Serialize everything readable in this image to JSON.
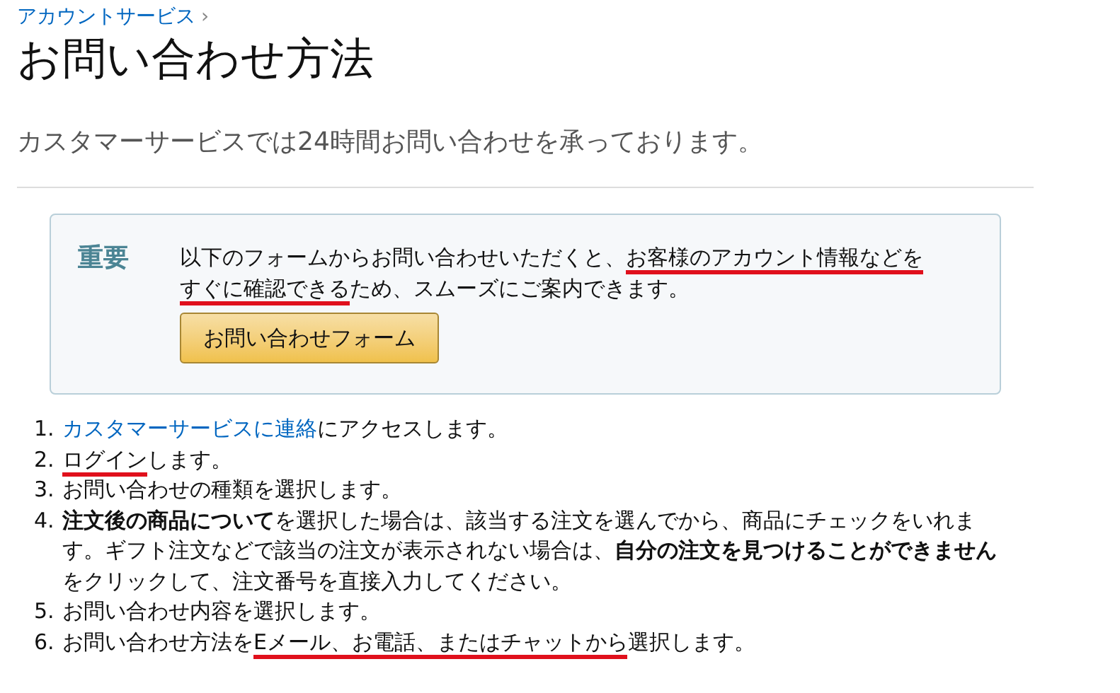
{
  "breadcrumb": {
    "label": "アカウントサービス",
    "separator": "›"
  },
  "title": "お問い合わせ方法",
  "subtitle": "カスタマーサービスでは24時間お問い合わせを承っております。",
  "notice": {
    "label": "重要",
    "parts": [
      {
        "text": "以下のフォームからお問い合わせいただくと、",
        "marked": false
      },
      {
        "text": "お客様のアカウント情報などを",
        "marked": true
      },
      {
        "text": "すぐに確認できる",
        "marked": true
      },
      {
        "text": "ため、スムーズにご案内できます。",
        "marked": false
      }
    ],
    "button": "お問い合わせフォーム"
  },
  "steps": [
    {
      "number": "1.",
      "link": "カスタマーサービスに連絡",
      "parts": [
        {
          "text": "にアクセスします。",
          "marked": false
        }
      ]
    },
    {
      "number": "2.",
      "parts": [
        {
          "text": "ログイン",
          "marked": true
        },
        {
          "text": "します。",
          "marked": false
        }
      ]
    },
    {
      "number": "3.",
      "parts": [
        {
          "text": "お問い合わせの種類を選択します。",
          "marked": false
        }
      ]
    },
    {
      "number": "4.",
      "parts": [
        {
          "text": "**注文後の商品について**を選択した場合は、該当する注文を選んでから、商品にチェックをいれます。ギフト注文などで該当の注文が表示されない場合は、**自分の注文を見つけることができません**をクリックして、注文番号を直接入力してください。",
          "marked": false
        }
      ]
    },
    {
      "number": "5.",
      "parts": [
        {
          "text": "お問い合わせ内容を選択します。",
          "marked": false
        }
      ]
    },
    {
      "number": "6.",
      "parts": [
        {
          "text": "お問い合わせ方法を",
          "marked": false
        },
        {
          "text": "Eメール、お電話、またはチャットから",
          "marked": true
        },
        {
          "text": "選択します。",
          "marked": false
        }
      ]
    }
  ]
}
